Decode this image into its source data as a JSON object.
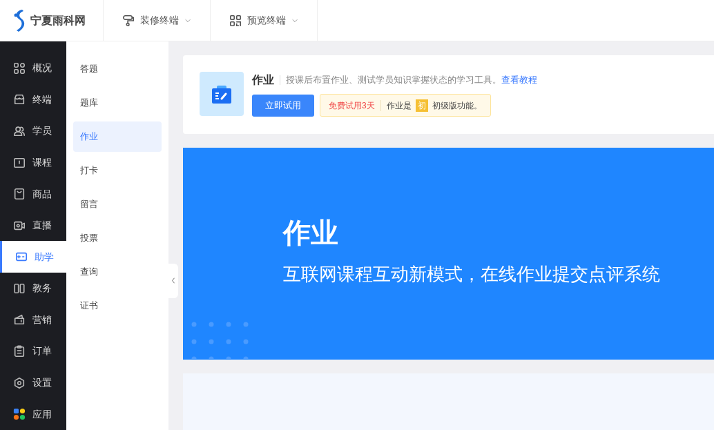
{
  "logo": {
    "text": "宁夏雨科网"
  },
  "top_menu": [
    {
      "label": "装修终端"
    },
    {
      "label": "预览终端"
    }
  ],
  "sidebar": {
    "items": [
      {
        "label": "概况",
        "selected": false
      },
      {
        "label": "终端",
        "selected": false
      },
      {
        "label": "学员",
        "selected": false
      },
      {
        "label": "课程",
        "selected": false
      },
      {
        "label": "商品",
        "selected": false
      },
      {
        "label": "直播",
        "selected": false
      },
      {
        "label": "助学",
        "selected": true
      },
      {
        "label": "教务",
        "selected": false
      },
      {
        "label": "营销",
        "selected": false
      },
      {
        "label": "订单",
        "selected": false
      },
      {
        "label": "设置",
        "selected": false
      },
      {
        "label": "应用",
        "selected": false
      }
    ]
  },
  "submenu": {
    "items": [
      {
        "label": "答题",
        "selected": false
      },
      {
        "label": "题库",
        "selected": false
      },
      {
        "label": "作业",
        "selected": true
      },
      {
        "label": "打卡",
        "selected": false
      },
      {
        "label": "留言",
        "selected": false
      },
      {
        "label": "投票",
        "selected": false
      },
      {
        "label": "查询",
        "selected": false
      },
      {
        "label": "证书",
        "selected": false
      }
    ]
  },
  "intro": {
    "title": "作业",
    "description": "授课后布置作业、测试学员知识掌握状态的学习工具。",
    "link": "查看教程",
    "button": "立即试用",
    "trial": "免费试用3天",
    "notice_prefix": "作业是",
    "level_badge": "初",
    "notice_suffix": "初级版功能。"
  },
  "banner": {
    "title": "作业",
    "subtitle": "互联网课程互动新模式，在线作业提交点评系统"
  }
}
